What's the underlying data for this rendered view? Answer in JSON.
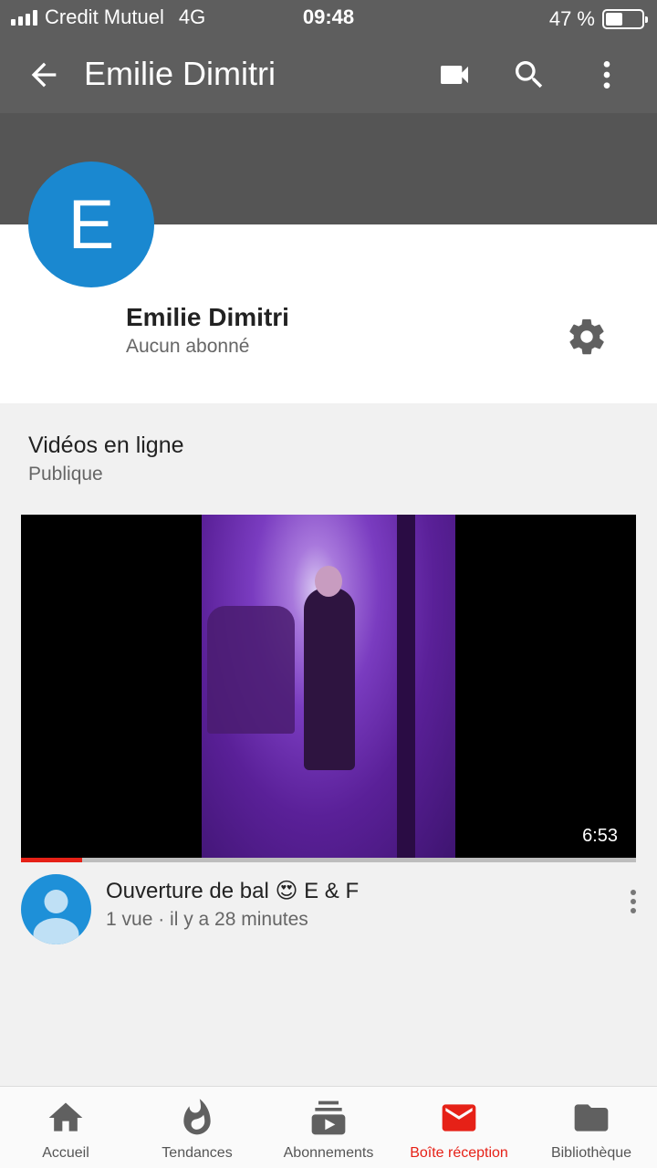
{
  "status_bar": {
    "carrier": "Credit Mutuel",
    "network": "4G",
    "time": "09:48",
    "battery_text": "47 %",
    "battery_level": 0.47
  },
  "app_bar": {
    "title": "Emilie Dimitri",
    "icons": [
      "back-arrow-icon",
      "video-camera-icon",
      "search-icon",
      "more-vert-icon"
    ]
  },
  "channel": {
    "avatar_letter": "E",
    "avatar_color": "#1a88d0",
    "name": "Emilie Dimitri",
    "subscribers": "Aucun abonné"
  },
  "section": {
    "title": "Vidéos en ligne",
    "subtitle": "Publique"
  },
  "video": {
    "duration": "6:53",
    "progress": 0.1,
    "title": "Ouverture de bal 😍 E & F",
    "meta": "1 vue · il y a 28 minutes"
  },
  "bottom_nav": {
    "items": [
      {
        "label": "Accueil",
        "icon": "home-icon",
        "active": false
      },
      {
        "label": "Tendances",
        "icon": "fire-icon",
        "active": false
      },
      {
        "label": "Abonnements",
        "icon": "subscriptions-icon",
        "active": false
      },
      {
        "label": "Boîte réception",
        "icon": "mail-icon",
        "active": true
      },
      {
        "label": "Bibliothèque",
        "icon": "folder-icon",
        "active": false
      }
    ]
  },
  "colors": {
    "app_bar": "#5e5e5e",
    "banner": "#555555",
    "accent": "#e62117"
  }
}
